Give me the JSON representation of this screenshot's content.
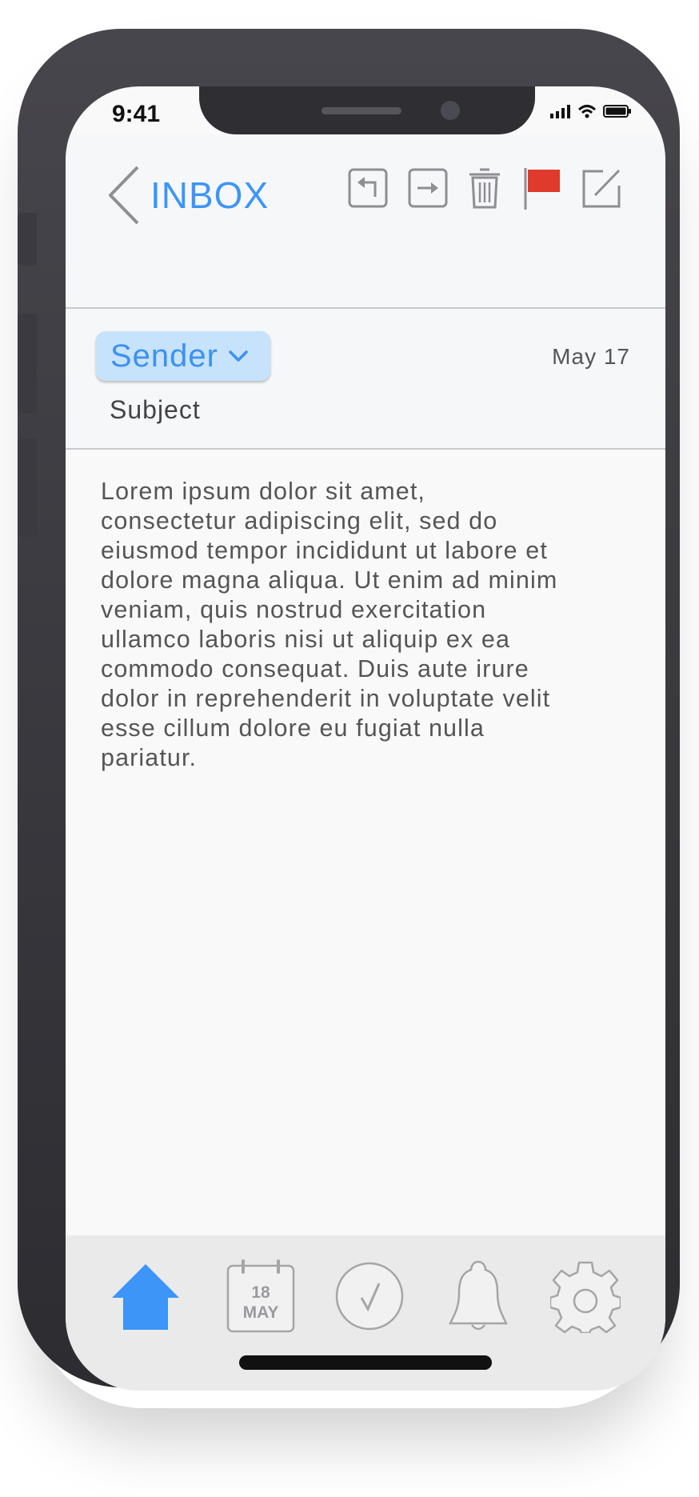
{
  "status_bar": {
    "time": "9:41"
  },
  "nav": {
    "back_label": "INBOX",
    "tools": [
      "reply-icon",
      "forward-icon",
      "trash-icon",
      "flag-icon",
      "compose-icon"
    ],
    "flag_color": "#e03a2c",
    "accent": "#3d95f7"
  },
  "message": {
    "sender_label": "Sender",
    "date": "May 17",
    "subject": "Subject",
    "body": "Lorem ipsum dolor sit amet,\nconsectetur adipiscing elit, sed do\neiusmod tempor incididunt ut labore et\ndolore magna aliqua. Ut enim ad minim\nveniam, quis nostrud exercitation\nullamco laboris nisi ut aliquip ex ea\ncommodo consequat. Duis aute irure\ndolor in reprehenderit in voluptate velit\nesse cillum dolore eu fugiat nulla\npariatur."
  },
  "tabbar": {
    "tabs": [
      "home-icon",
      "calendar-icon",
      "check-icon",
      "bell-icon",
      "gear-icon"
    ],
    "calendar_day": "18",
    "calendar_month": "MAY",
    "active_color": "#3d95f7"
  }
}
